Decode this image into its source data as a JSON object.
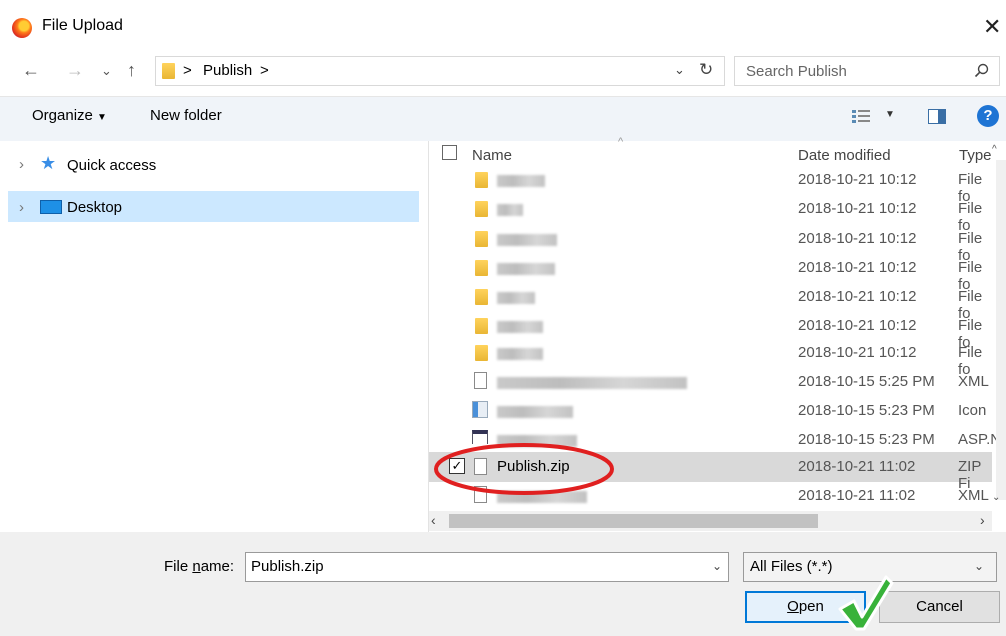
{
  "window": {
    "title": "File Upload"
  },
  "nav": {
    "breadcrumb_sep": ">",
    "breadcrumb_folder": "Publish",
    "breadcrumb_trail": ">"
  },
  "search": {
    "placeholder": "Search Publish"
  },
  "toolbar": {
    "organize_label": "Organize",
    "new_folder_label": "New folder"
  },
  "sidebar": {
    "items": [
      {
        "label": "Quick access"
      },
      {
        "label": "Desktop"
      }
    ]
  },
  "columns": {
    "name": "Name",
    "date": "Date modified",
    "type": "Type"
  },
  "files": [
    {
      "date": "2018-10-21 10:12",
      "type": "File fo"
    },
    {
      "date": "2018-10-21 10:12",
      "type": "File fo"
    },
    {
      "date": "2018-10-21 10:12",
      "type": "File fo"
    },
    {
      "date": "2018-10-21 10:12",
      "type": "File fo"
    },
    {
      "date": "2018-10-21 10:12",
      "type": "File fo"
    },
    {
      "date": "2018-10-21 10:12",
      "type": "File fo"
    },
    {
      "date": "2018-10-21 10:12",
      "type": "File fo"
    },
    {
      "date": "2018-10-15 5:25 PM",
      "type": "XML"
    },
    {
      "date": "2018-10-15 5:23 PM",
      "type": "Icon"
    },
    {
      "date": "2018-10-15 5:23 PM",
      "type": "ASP.N"
    },
    {
      "name": "Publish.zip",
      "date": "2018-10-21 11:02",
      "type": "ZIP Fi"
    },
    {
      "date": "2018-10-21 11:02",
      "type": "XML"
    }
  ],
  "bottom": {
    "file_name_label_pre": "File ",
    "file_name_label_u": "n",
    "file_name_label_post": "ame:",
    "file_name_value": "Publish.zip",
    "filter_value": "All Files (*.*)",
    "open_u": "O",
    "open_rest": "pen",
    "cancel_label": "Cancel"
  },
  "colors": {
    "accent": "#0078d7",
    "selection": "#cce8ff",
    "selected_row": "#d9d9d9",
    "annotation_red": "#e02020",
    "annotation_green": "#2fa52f"
  }
}
